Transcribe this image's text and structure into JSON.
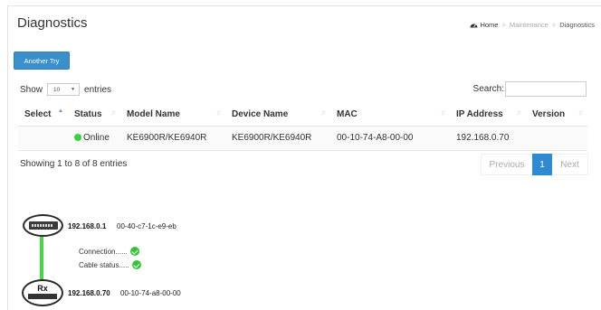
{
  "page": {
    "title": "Diagnostics"
  },
  "breadcrumb": {
    "home": "Home",
    "section": "Maintenance",
    "current": "Diagnostics"
  },
  "toolbar": {
    "another_try_label": "Another Try"
  },
  "table_controls": {
    "show_label": "Show",
    "page_length": "10",
    "entries_label": "entries",
    "search_label": "Search:",
    "search_value": ""
  },
  "table": {
    "columns": [
      "Select",
      "Status",
      "Model Name",
      "Device Name",
      "MAC",
      "IP Address",
      "Version"
    ],
    "sorted_column": "Select",
    "rows": [
      {
        "select": "",
        "status": "Online",
        "model_name": "KE6900R/KE6940R",
        "device_name": "KE6900R/KE6940R",
        "mac": "00-10-74-A8-00-00",
        "ip": "192.168.0.70",
        "version": ""
      }
    ]
  },
  "pagination": {
    "info": "Showing 1 to 8 of 8 entries",
    "previous": "Previous",
    "current_page": "1",
    "next": "Next"
  },
  "topology": {
    "switch": {
      "icon": "network-switch-icon",
      "ip": "192.168.0.1",
      "mac": "00-40-c7-1c-e9-eb"
    },
    "checks": [
      {
        "label": "Connection......",
        "status": "ok"
      },
      {
        "label": "Cable status.....",
        "status": "ok"
      }
    ],
    "receiver": {
      "icon": "rx-device-icon",
      "badge": "Rx",
      "ip": "192.168.0.70",
      "mac": "00-10-74-a8-00-00"
    }
  },
  "colors": {
    "primary_button": "#3a8fcd",
    "online": "#3bd13b",
    "link_line": "#46d646",
    "active_page": "#2e8ad3"
  }
}
